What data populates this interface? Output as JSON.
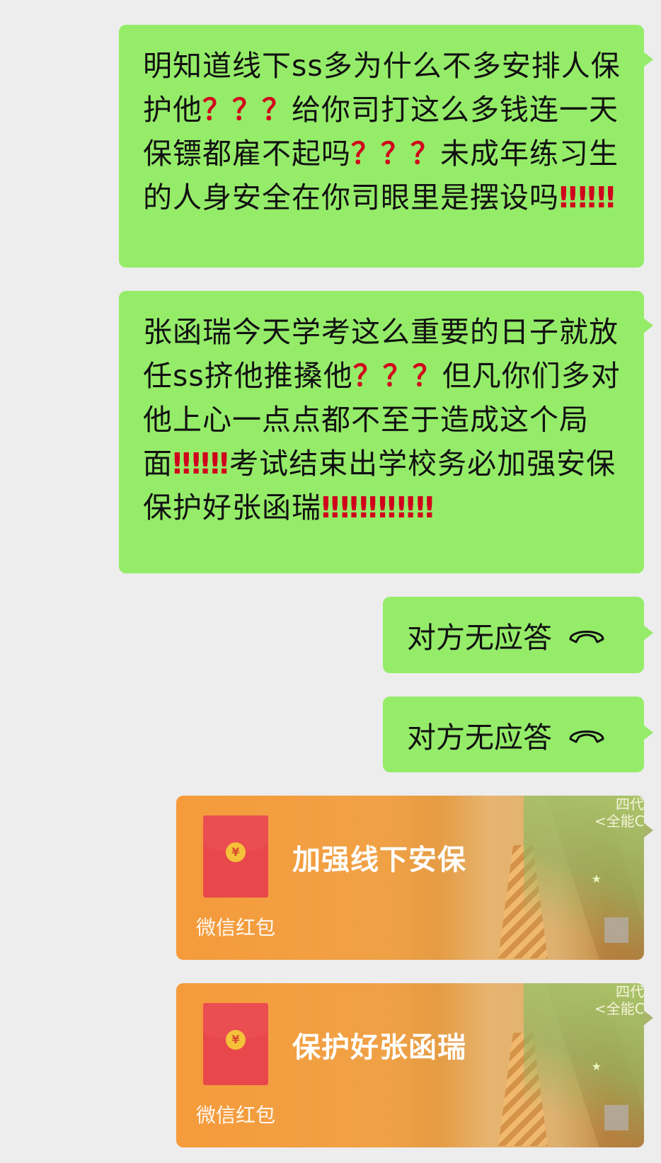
{
  "messages": [
    {
      "type": "text",
      "segments": [
        {
          "text": "明知道线下ss多为什么不多安排人保护他",
          "red": false
        },
        {
          "text": "？？？",
          "red": true
        },
        {
          "text": "给你司打这么多钱连一天保镖都雇不起吗",
          "red": false
        },
        {
          "text": "？？？",
          "red": true
        },
        {
          "text": "未成年练习生的人身安全在你司眼里是摆设吗",
          "red": false
        },
        {
          "text": "‼‼‼",
          "red": true
        }
      ]
    },
    {
      "type": "text",
      "segments": [
        {
          "text": "张函瑞今天学考这么重要的日子就放任ss挤他推搡他",
          "red": false
        },
        {
          "text": "？？？",
          "red": true
        },
        {
          "text": "但凡你们多对他上心一点点都不至于造成这个局面",
          "red": false
        },
        {
          "text": "‼‼‼",
          "red": true
        },
        {
          "text": "考试结束出学校务必加强安保保护好张函瑞",
          "red": false
        },
        {
          "text": "‼‼‼‼‼‼",
          "red": true
        }
      ]
    },
    {
      "type": "call",
      "label": "对方无应答",
      "icon": "hangup-phone-icon"
    },
    {
      "type": "call",
      "label": "对方无应答",
      "icon": "hangup-phone-icon"
    },
    {
      "type": "redpacket",
      "title": "加强线下安保",
      "label": "微信红包",
      "cover_text": "四代\n<全能C"
    },
    {
      "type": "redpacket",
      "title": "保护好张函瑞",
      "label": "微信红包",
      "cover_text": "四代\n<全能C"
    }
  ],
  "colors": {
    "background": "#ededed",
    "bubble_green": "#95ec69",
    "emphasis_red": "#d0021b",
    "redpacket_orange": "#f59b3b"
  }
}
